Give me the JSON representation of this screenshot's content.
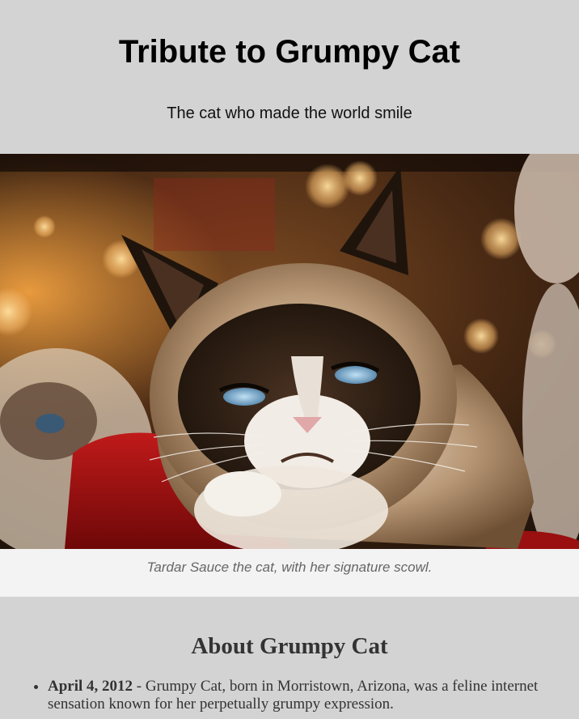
{
  "header": {
    "title": "Tribute to Grumpy Cat",
    "subtitle": "The cat who made the world smile"
  },
  "figure": {
    "image_subject": "Grumpy Cat photo — cat with dark face, blue eyes, frown, on red fabric, bokeh background",
    "caption": "Tardar Sauce the cat, with her signature scowl."
  },
  "about": {
    "heading": "About Grumpy Cat",
    "timeline": [
      {
        "date": "April 4, 2012",
        "separator": " - ",
        "text": "Grumpy Cat, born in Morristown, Arizona, was a feline internet sensation known for her perpetually grumpy expression."
      }
    ]
  },
  "colors": {
    "page_bg": "#d3d3d3",
    "caption_bg": "#f3f3f3",
    "caption_text": "#666666",
    "heading_text": "#333333"
  }
}
